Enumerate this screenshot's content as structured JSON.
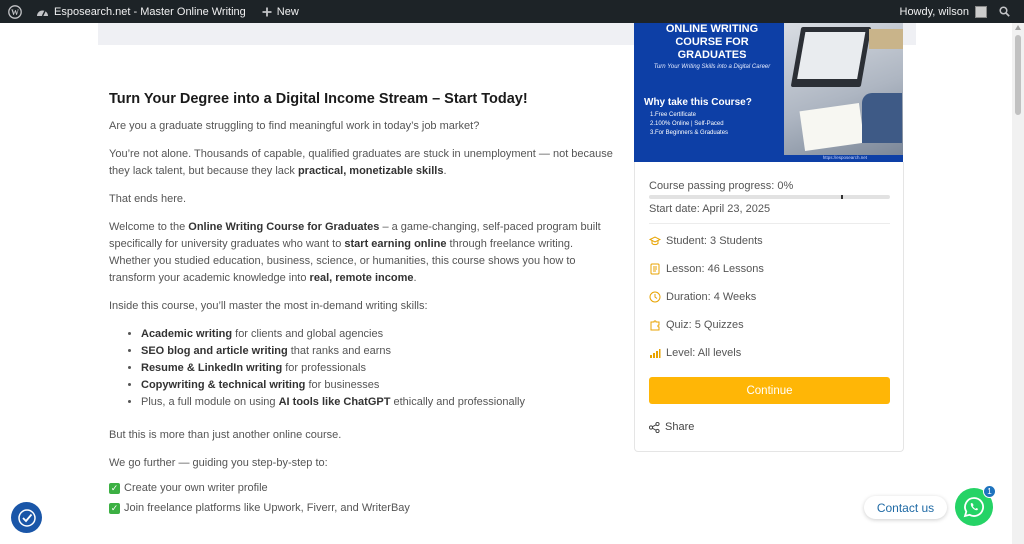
{
  "adminbar": {
    "site_name": "Esposearch.net - Master Online Writing",
    "new_label": "New",
    "greeting": "Howdy, wilson"
  },
  "article": {
    "heading": "Turn Your Degree into a Digital Income Stream – Start Today!",
    "p1": "Are you a graduate struggling to find meaningful work in today’s job market?",
    "p2_a": "You’re not alone. Thousands of capable, qualified graduates are stuck in unemployment — not because they lack talent, but because they lack ",
    "p2_b": "practical, monetizable skills",
    "p2_c": ".",
    "p3": "That ends here.",
    "p4_a": "Welcome to the ",
    "p4_b": "Online Writing Course for Graduates",
    "p4_c": " – a game-changing, self-paced program built specifically for university graduates who want to ",
    "p4_d": "start earning online",
    "p4_e": " through freelance writing. Whether you studied education, business, science, or humanities, this course shows you how to transform your academic knowledge into ",
    "p4_f": "real, remote income",
    "p4_g": ".",
    "p5": "Inside this course, you’ll master the most in-demand writing skills:",
    "skills": [
      {
        "bold": "Academic writing",
        "rest": " for clients and global agencies"
      },
      {
        "bold": "SEO blog and article writing",
        "rest": " that ranks and earns"
      },
      {
        "bold": "Resume & LinkedIn writing",
        "rest": " for professionals"
      },
      {
        "bold": "Copywriting & technical writing",
        "rest": " for businesses"
      },
      {
        "pre": "Plus, a full module on using ",
        "bold": "AI tools like ChatGPT",
        "rest": " ethically and professionally"
      }
    ],
    "p6": "But this is more than just another online course.",
    "p7": "We go further — guiding you step-by-step to:",
    "checks": [
      "Create your own writer profile",
      "Join freelance platforms like Upwork, Fiverr, and WriterBay"
    ]
  },
  "banner": {
    "title": "ONLINE WRITING COURSE FOR GRADUATES",
    "subtitle": "Turn Your Writing Skills into a Digital Career",
    "why": "Why take this Course?",
    "points": [
      "1.Free Certificate",
      "2.100% Online | Self-Paced",
      "3.For Beginners & Graduates"
    ],
    "url": "https://esposearch.net"
  },
  "course": {
    "progress_label": "Course passing progress: 0%",
    "progress_fraction": 0,
    "start_date": "Start date: April 23, 2025",
    "student": "Student: 3 Students",
    "lesson": "Lesson: 46 Lessons",
    "duration": "Duration: 4 Weeks",
    "quiz": "Quiz: 5 Quizzes",
    "level": "Level: All levels",
    "continue_label": "Continue",
    "share_label": "Share"
  },
  "widgets": {
    "contact_label": "Contact us",
    "badge_count": "1"
  },
  "colors": {
    "accent": "#ffb606",
    "icon": "#e8a300",
    "banner": "#0d3fa6",
    "whatsapp": "#25d366"
  }
}
